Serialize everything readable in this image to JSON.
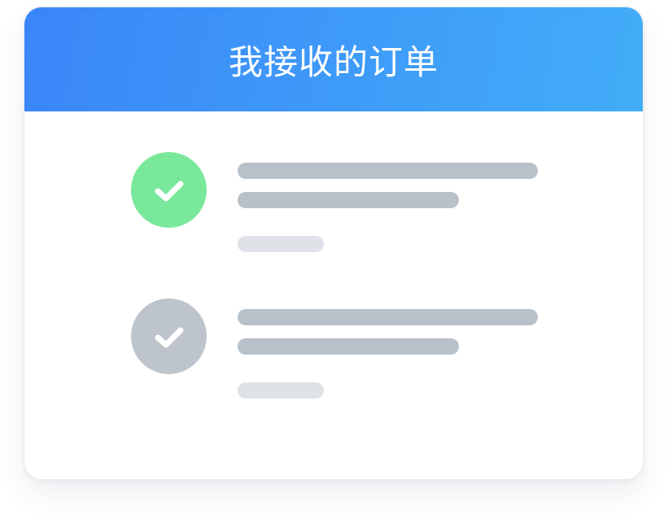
{
  "header": {
    "title": "我接收的订单",
    "gradient_start": "#3a86f8",
    "gradient_end": "#42adf8"
  },
  "orders": [
    {
      "status_icon": "check-icon",
      "status": "completed",
      "status_color": "#7ae89b",
      "line_color": "#b8c0ca",
      "meta_color": "#dfe3e8"
    },
    {
      "status_icon": "check-icon",
      "status": "received",
      "status_color": "#bec4cc",
      "line_color": "#b8c0ca",
      "meta_color": "#dfe3e8"
    }
  ]
}
